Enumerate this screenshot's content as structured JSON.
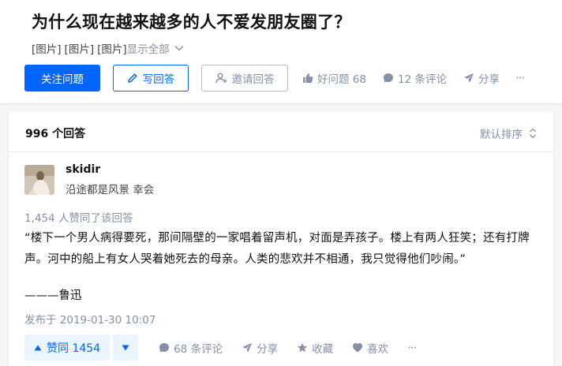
{
  "question": {
    "title": "为什么现在越来越多的人不爱发朋友圈了？",
    "image_tags": [
      "[图片]",
      "[图片]",
      "[图片]"
    ],
    "show_all": "显示全部"
  },
  "actions": {
    "follow": "关注问题",
    "write_answer": "写回答",
    "invite": "邀请回答",
    "good_question": "好问题 68",
    "comments": "12 条评论",
    "share": "分享",
    "more": "···"
  },
  "answers": {
    "count": "996 个回答",
    "sort": "默认排序"
  },
  "answer": {
    "author": "skidir",
    "bio": "沿途都是风景 幸会",
    "voters": "1,454 人赞同了该回答",
    "content": "“楼下一个男人病得要死，那间隔壁的一家唱着留声机，对面是弄孩子。楼上有两人狂笑；还有打牌声。河中的船上有女人哭着她死去的母亲。人类的悲欢并不相通，我只觉得他们吵闹。”",
    "signature": "———鲁迅",
    "published": "发布于 2019-01-30 10:07",
    "vote_up": "赞同 1454",
    "comments": "68 条评论",
    "share": "分享",
    "collect": "收藏",
    "like": "喜欢",
    "more": "···"
  },
  "colors": {
    "primary": "#0066ff",
    "meta_gray": "#8590a6",
    "vote_bg": "#ebf5ff"
  },
  "icons": [
    "pencil-icon",
    "invite-user-icon",
    "thumb-up-icon",
    "comment-bubble-icon",
    "share-plane-icon",
    "ellipsis-icon",
    "sort-chevron-icon",
    "chevron-down-icon",
    "triangle-up-icon",
    "triangle-down-icon",
    "star-icon",
    "heart-icon"
  ]
}
